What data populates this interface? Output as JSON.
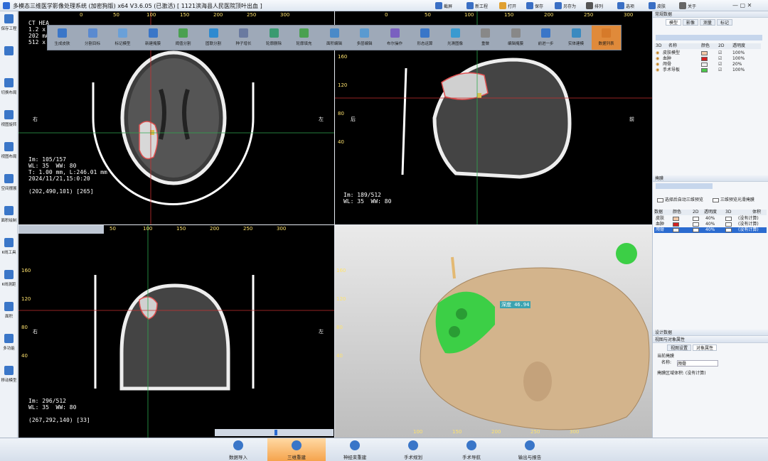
{
  "window": {
    "title": "多模态三维医学影像处理系统  (加密狗版) x64 V3.6.05 (已激活) [ 1121滨海县人民医院顶叶出血 ]"
  },
  "titlebar_tools": [
    {
      "label": "截屏"
    },
    {
      "label": "新工程"
    },
    {
      "label": "打开"
    },
    {
      "label": "保存"
    },
    {
      "label": "另存为"
    },
    {
      "label": "排列"
    },
    {
      "label": "选项"
    },
    {
      "label": "皮肤"
    },
    {
      "label": "关于"
    }
  ],
  "left_toolbar": [
    {
      "label": "保存工程"
    },
    {
      "label": ""
    },
    {
      "label": "切换布局"
    },
    {
      "label": "视图旋转"
    },
    {
      "label": "视图布局"
    },
    {
      "label": "空间摆展"
    },
    {
      "label": "面积绘制"
    },
    {
      "label": "K线工具"
    },
    {
      "label": "K线测距"
    },
    {
      "label": "面积"
    },
    {
      "label": "多功能"
    },
    {
      "label": "移动模型"
    }
  ],
  "ribbon": [
    {
      "label": "生成皮肤"
    },
    {
      "label": "分割目标"
    },
    {
      "label": "标记模型"
    },
    {
      "label": "新建掩膜"
    },
    {
      "label": "阈值分割"
    },
    {
      "label": "固联分割"
    },
    {
      "label": "种子增长"
    },
    {
      "label": "轮廓删除"
    },
    {
      "label": "轮廓填充"
    },
    {
      "label": "面积编辑"
    },
    {
      "label": "多层编辑"
    },
    {
      "label": "布尔操作"
    },
    {
      "label": "形态运算"
    },
    {
      "label": "光滑图像"
    },
    {
      "label": "重做"
    },
    {
      "label": "编辑掩膜"
    },
    {
      "label": "前进一步"
    },
    {
      "label": "实体建模"
    },
    {
      "label": "数据列表"
    }
  ],
  "axial": {
    "im": "Im: 105/157",
    "wl": "WL: 35  WW: 80",
    "t": "T: 1.00 mm, L:246.01 mm",
    "date": "2024/11/21,15:0:20",
    "coord": "(202,490,101) [265]",
    "header": "CT HEA\n1.2 x \n202 mA\n512 x",
    "left": "右",
    "right": "左",
    "rulers_x": [
      "0",
      "50",
      "100",
      "150",
      "200",
      "250",
      "300"
    ],
    "rulers_y": [
      "160",
      "120",
      "80",
      "40"
    ]
  },
  "sagittal": {
    "im": "Im: 189/512",
    "wl": "WL: 35  WW: 80",
    "left": "后",
    "right": "前",
    "rulers_x": [
      "0",
      "50",
      "100",
      "150",
      "200",
      "250",
      "300"
    ],
    "rulers_y": [
      "160",
      "120",
      "80",
      "40"
    ]
  },
  "coronal": {
    "im": "Im: 296/512",
    "wl": "WL: 35  WW: 80",
    "coord": "(267,292,140) [33]",
    "left": "右",
    "right": "左",
    "rulers_x": [
      "50",
      "100",
      "150",
      "200",
      "250",
      "300"
    ],
    "rulers_y": [
      "160",
      "120",
      "80",
      "40"
    ]
  },
  "view3d": {
    "measure": "深度 46.94",
    "rulers_x": [
      "100",
      "150",
      "200",
      "250",
      "300"
    ],
    "rulers_y": [
      "160",
      "120",
      "80",
      "40"
    ]
  },
  "right_panel": {
    "section_data": "常规数据",
    "tabs": [
      "模型",
      "影像",
      "测量",
      "标记"
    ],
    "model_cols": {
      "c3d": "3D",
      "name": "名称",
      "color": "颜色",
      "c2d": "2D",
      "opacity": "透明度"
    },
    "models": [
      {
        "name": "皮肤模型",
        "color": "#f2c9a8",
        "opacity": "100%"
      },
      {
        "name": "血肿",
        "color": "#d62020",
        "opacity": "100%"
      },
      {
        "name": "颅骨",
        "color": "#f0f0f0",
        "opacity": "20%"
      },
      {
        "name": "手术导板",
        "color": "#4cc84c",
        "opacity": "100%"
      }
    ],
    "section_mask": "掩膜",
    "check1": "选择后自动三维预览",
    "check2": "三维预览光滑掩膜",
    "mask_cols": {
      "data": "数据",
      "color": "颜色",
      "c2d": "2D",
      "opacity": "透明度",
      "c3d": "3D",
      "volume": "体积"
    },
    "masks": [
      {
        "name": "皮肤",
        "color": "#f2c9a8",
        "opacity": "40%",
        "volume": "(没有计算)"
      },
      {
        "name": "血肿",
        "color": "#d62020",
        "opacity": "40%",
        "volume": "(没有计算)"
      },
      {
        "name": "颅骨",
        "color": "#f0f0f0",
        "opacity": "40%",
        "volume": "(没有计算)"
      }
    ],
    "section_design": "设计数据",
    "section_props": "视图与对象属性",
    "props_tabs": [
      "视图设置",
      "对象属性"
    ],
    "current_mask": "当前掩膜",
    "name_label": "名称:",
    "name_value": "颅骨",
    "volume_line": "掩膜区域体积: (没有计算)"
  },
  "bottom_bar": [
    {
      "label": "数据导入"
    },
    {
      "label": "三维重建"
    },
    {
      "label": "神经束重建"
    },
    {
      "label": "手术规划"
    },
    {
      "label": "手术导航"
    },
    {
      "label": "输出与报告"
    }
  ]
}
